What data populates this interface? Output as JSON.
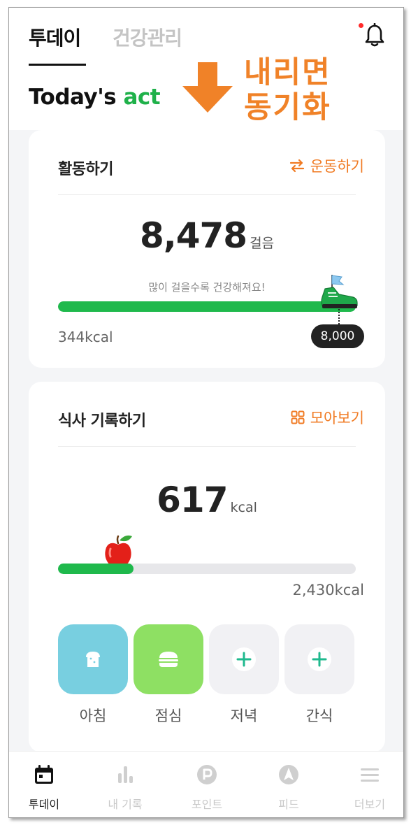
{
  "header": {
    "tabs": [
      {
        "label": "투데이",
        "active": true
      },
      {
        "label": "건강관리",
        "active": false
      }
    ],
    "notification_icon": "bell-icon",
    "has_notification": true,
    "greeting_prefix": "Today's",
    "greeting_accent": "act"
  },
  "annotation": {
    "arrow_icon": "down-arrow-icon",
    "line1": "내리면",
    "line2": "동기화"
  },
  "activity": {
    "title": "활동하기",
    "link_label": "운동하기",
    "link_icon": "swap-arrows-icon",
    "steps": "8,478",
    "steps_unit": "걸음",
    "hint": "많이 걸을수록 건강해져요!",
    "progress_fraction": 1.0,
    "burned_kcal": "344kcal",
    "goal_steps": "8,000",
    "goal_icon": "sneaker-flag-icon"
  },
  "meal": {
    "title": "식사 기록하기",
    "link_label": "모아보기",
    "link_icon": "grid-icon",
    "kcal": "617",
    "kcal_unit": "kcal",
    "progress_fraction": 0.254,
    "goal_kcal": "2,430kcal",
    "progress_icon": "apple-icon",
    "buttons": [
      {
        "label": "아침",
        "icon": "bread-icon",
        "color": "#78cfe0",
        "recorded": true
      },
      {
        "label": "점심",
        "icon": "burger-icon",
        "color": "#8ee063",
        "recorded": true
      },
      {
        "label": "저녁",
        "icon": "plus-icon",
        "color": "#f1f1f4",
        "recorded": false
      },
      {
        "label": "간식",
        "icon": "plus-icon",
        "color": "#f1f1f4",
        "recorded": false
      }
    ]
  },
  "bottom_nav": [
    {
      "label": "투데이",
      "icon": "calendar-icon",
      "active": true
    },
    {
      "label": "내 기록",
      "icon": "bar-chart-icon",
      "active": false
    },
    {
      "label": "포인트",
      "icon": "point-coin-icon",
      "active": false
    },
    {
      "label": "피드",
      "icon": "compass-icon",
      "active": false
    },
    {
      "label": "더보기",
      "icon": "menu-icon",
      "active": false
    }
  ],
  "colors": {
    "accent_green": "#1fb14a",
    "accent_orange": "#f07a22",
    "progress_green": "#1fb94c",
    "text_dark": "#222222"
  }
}
